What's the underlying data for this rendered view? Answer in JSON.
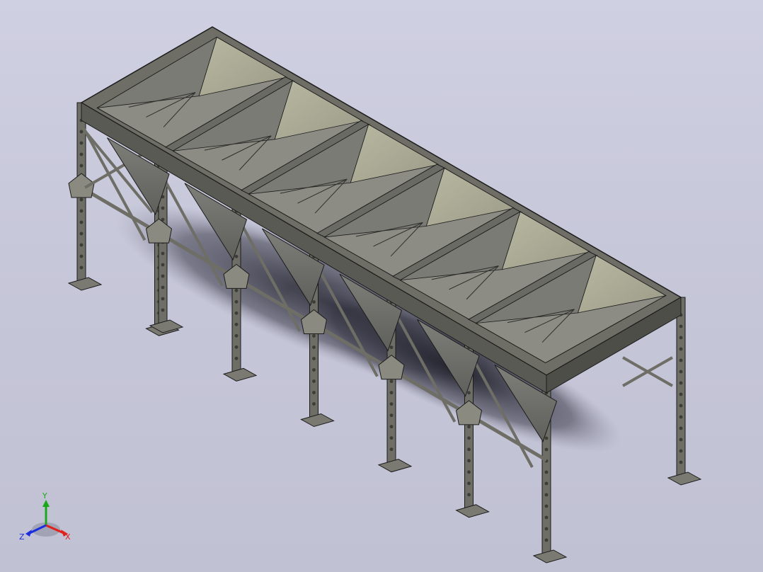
{
  "viewport": {
    "background_top": "#cfd0e2",
    "background_bottom": "#c0c1d3"
  },
  "model": {
    "type": "hopper-bin-structure",
    "hopper_count": 6,
    "leg_count": 14,
    "colors": {
      "frame": "#6e6e66",
      "frame_dark": "#3d3d38",
      "hopper_light": "#a9a995",
      "hopper_mid": "#8c8c84",
      "hopper_dark": "#5c5c58",
      "shadow": "#2a2a35",
      "edge": "#1c1c1c"
    }
  },
  "triad": {
    "x_label": "X",
    "y_label": "Y",
    "z_label": "Z",
    "x_color": "#e0201a",
    "y_color": "#1aa81a",
    "z_color": "#1a2ee0"
  }
}
